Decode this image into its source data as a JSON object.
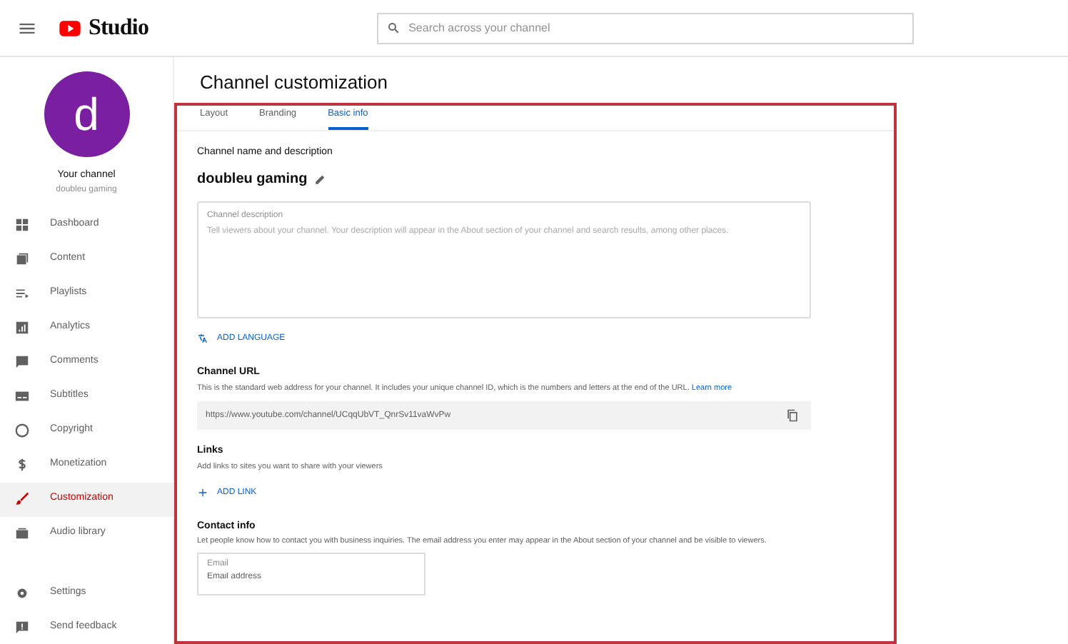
{
  "header": {
    "logo_text": "Studio",
    "search": {
      "placeholder": "Search across your channel"
    }
  },
  "profile": {
    "initial": "d",
    "title": "Your channel",
    "name": "doubleu gaming"
  },
  "sidebar": {
    "items": [
      {
        "label": "Dashboard",
        "selected": false
      },
      {
        "label": "Content",
        "selected": false
      },
      {
        "label": "Playlists",
        "selected": false
      },
      {
        "label": "Analytics",
        "selected": false
      },
      {
        "label": "Comments",
        "selected": false
      },
      {
        "label": "Subtitles",
        "selected": false
      },
      {
        "label": "Copyright",
        "selected": false
      },
      {
        "label": "Monetization",
        "selected": false
      },
      {
        "label": "Customization",
        "selected": true
      },
      {
        "label": "Audio library",
        "selected": false
      }
    ],
    "footer_items": [
      {
        "label": "Settings"
      },
      {
        "label": "Send feedback"
      }
    ]
  },
  "page_title": "Channel customization",
  "tabs": [
    {
      "label": "Layout",
      "selected": false
    },
    {
      "label": "Branding",
      "selected": false
    },
    {
      "label": "Basic info",
      "selected": true
    }
  ],
  "basic_info": {
    "name_section": {
      "heading": "Channel name and description",
      "channel_name": "doubleu gaming"
    },
    "description": {
      "label": "Channel description",
      "placeholder": "Tell viewers about your channel. Your description will appear in the About section of your channel and search results, among other places."
    },
    "add_language": "ADD LANGUAGE",
    "url_section": {
      "heading": "Channel URL",
      "text": "This is the standard web address for your channel. It includes your unique channel ID, which is the numbers and letters at the end of the URL.",
      "link": "Learn more",
      "url": "https://www.youtube.com/channel/UCqqUbVT_QnrSv11vaWvPw"
    },
    "links_section": {
      "heading": "Links",
      "text": "Add links to sites you want to share with your viewers",
      "add_link": "ADD LINK"
    },
    "contact_section": {
      "heading": "Contact info",
      "text": "Let people know how to contact you with business inquiries. The email address you enter may appear in the About section of your channel and be visible to viewers.",
      "email": {
        "label": "Email",
        "placeholder": "Email address"
      }
    }
  }
}
